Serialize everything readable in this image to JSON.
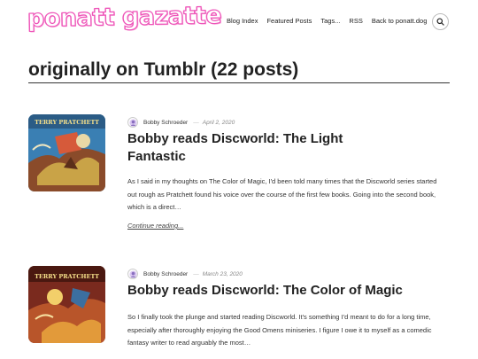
{
  "site": {
    "logo_text": "ponatt gazatte"
  },
  "nav": {
    "items": [
      "Blog Index",
      "Featured Posts",
      "Tags...",
      "RSS",
      "Back to ponatt.dog"
    ]
  },
  "archive": {
    "title": "originally on Tumblr (22 posts)"
  },
  "posts": [
    {
      "cover_label": "TERRY PRATCHETT",
      "author": "Bobby Schroeder",
      "date": "April 2, 2020",
      "title": "Bobby reads Discworld: The Light Fantastic",
      "excerpt": "As I said in my thoughts on The Color of Magic, I'd been told many times that the Discworld series started out rough as Pratchett found his voice over the course of the first few books. Going into the second book, which is a direct…",
      "continue_label": "Continue reading..."
    },
    {
      "cover_label": "TERRY PRATCHETT",
      "author": "Bobby Schroeder",
      "date": "March 23, 2020",
      "title": "Bobby reads Discworld: The Color of Magic",
      "excerpt": "So I finally took the plunge and started reading Discworld. It's something I'd meant to do for a long time, especially after thoroughly enjoying the Good Omens miniseries. I figure I owe it to myself as a comedic fantasy writer to read arguably the most…",
      "continue_label": ""
    }
  ],
  "colors": {
    "logo_pink": "#ee55b9",
    "text": "#222222",
    "meta_gray": "#888888"
  }
}
